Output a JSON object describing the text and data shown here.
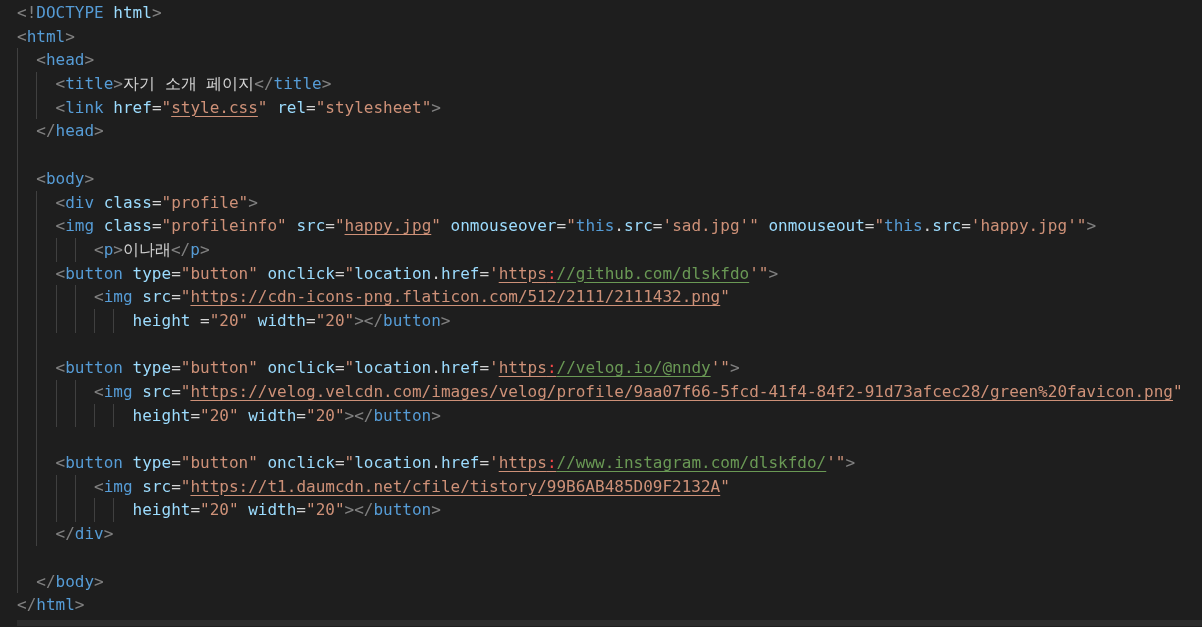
{
  "editor": {
    "lines": [
      {
        "kind": "code",
        "tokens": [
          {
            "kind": "punct",
            "text": "<!"
          },
          {
            "kind": "tag",
            "text": "DOCTYPE"
          },
          {
            "kind": "attr",
            "text": " html"
          },
          {
            "kind": "punct",
            "text": ">"
          }
        ]
      },
      {
        "kind": "code",
        "tokens": [
          {
            "kind": "punct",
            "text": "<"
          },
          {
            "kind": "tag",
            "text": "html"
          },
          {
            "kind": "punct",
            "text": ">"
          }
        ]
      },
      {
        "kind": "code",
        "tokens": [
          {
            "kind": "punct",
            "text": "  <"
          },
          {
            "kind": "tag",
            "text": "head"
          },
          {
            "kind": "punct",
            "text": ">"
          }
        ]
      },
      {
        "kind": "code",
        "tokens": [
          {
            "kind": "punct",
            "text": "    <"
          },
          {
            "kind": "tag",
            "text": "title"
          },
          {
            "kind": "punct",
            "text": ">"
          },
          {
            "kind": "text",
            "text": "자기 소개 페이지"
          },
          {
            "kind": "punct",
            "text": "</"
          },
          {
            "kind": "tag",
            "text": "title"
          },
          {
            "kind": "punct",
            "text": ">"
          }
        ]
      },
      {
        "kind": "code",
        "tokens": [
          {
            "kind": "punct",
            "text": "    <"
          },
          {
            "kind": "tag",
            "text": "link"
          },
          {
            "kind": "attr",
            "text": " href"
          },
          {
            "kind": "text",
            "text": "="
          },
          {
            "kind": "string",
            "text": "\""
          },
          {
            "kind": "link",
            "text": "style.css"
          },
          {
            "kind": "string",
            "text": "\""
          },
          {
            "kind": "attr",
            "text": " rel"
          },
          {
            "kind": "text",
            "text": "="
          },
          {
            "kind": "string",
            "text": "\"stylesheet\""
          },
          {
            "kind": "punct",
            "text": ">"
          }
        ]
      },
      {
        "kind": "code",
        "tokens": [
          {
            "kind": "punct",
            "text": "  </"
          },
          {
            "kind": "tag",
            "text": "head"
          },
          {
            "kind": "punct",
            "text": ">"
          }
        ]
      },
      {
        "kind": "blank"
      },
      {
        "kind": "code",
        "tokens": [
          {
            "kind": "punct",
            "text": "  <"
          },
          {
            "kind": "tag",
            "text": "body"
          },
          {
            "kind": "punct",
            "text": ">"
          }
        ]
      },
      {
        "kind": "code",
        "tokens": [
          {
            "kind": "punct",
            "text": "    <"
          },
          {
            "kind": "tag",
            "text": "div"
          },
          {
            "kind": "attr",
            "text": " class"
          },
          {
            "kind": "text",
            "text": "="
          },
          {
            "kind": "string",
            "text": "\"profile\""
          },
          {
            "kind": "punct",
            "text": ">"
          }
        ]
      },
      {
        "kind": "code",
        "tokens": [
          {
            "kind": "punct",
            "text": "    <"
          },
          {
            "kind": "tag",
            "text": "img"
          },
          {
            "kind": "attr",
            "text": " class"
          },
          {
            "kind": "text",
            "text": "="
          },
          {
            "kind": "string",
            "text": "\"profileinfo\""
          },
          {
            "kind": "attr",
            "text": " src"
          },
          {
            "kind": "text",
            "text": "="
          },
          {
            "kind": "string",
            "text": "\""
          },
          {
            "kind": "link",
            "text": "happy.jpg"
          },
          {
            "kind": "string",
            "text": "\""
          },
          {
            "kind": "attr",
            "text": " onmouseover"
          },
          {
            "kind": "text",
            "text": "="
          },
          {
            "kind": "string",
            "text": "\""
          },
          {
            "kind": "keyword",
            "text": "this"
          },
          {
            "kind": "text",
            "text": "."
          },
          {
            "kind": "prop",
            "text": "src"
          },
          {
            "kind": "text",
            "text": "="
          },
          {
            "kind": "string",
            "text": "'sad.jpg'\""
          },
          {
            "kind": "attr",
            "text": " onmouseout"
          },
          {
            "kind": "text",
            "text": "="
          },
          {
            "kind": "string",
            "text": "\""
          },
          {
            "kind": "keyword",
            "text": "this"
          },
          {
            "kind": "text",
            "text": "."
          },
          {
            "kind": "prop",
            "text": "src"
          },
          {
            "kind": "text",
            "text": "="
          },
          {
            "kind": "string",
            "text": "'happy.jpg'\""
          },
          {
            "kind": "punct",
            "text": ">"
          }
        ]
      },
      {
        "kind": "code",
        "tokens": [
          {
            "kind": "punct",
            "text": "        <"
          },
          {
            "kind": "tag",
            "text": "p"
          },
          {
            "kind": "punct",
            "text": ">"
          },
          {
            "kind": "text",
            "text": "이나래"
          },
          {
            "kind": "punct",
            "text": "</"
          },
          {
            "kind": "tag",
            "text": "p"
          },
          {
            "kind": "punct",
            "text": ">"
          }
        ]
      },
      {
        "kind": "code",
        "tokens": [
          {
            "kind": "punct",
            "text": "    <"
          },
          {
            "kind": "tag",
            "text": "button"
          },
          {
            "kind": "attr",
            "text": " type"
          },
          {
            "kind": "text",
            "text": "="
          },
          {
            "kind": "string",
            "text": "\"button\""
          },
          {
            "kind": "attr",
            "text": " onclick"
          },
          {
            "kind": "text",
            "text": "="
          },
          {
            "kind": "string",
            "text": "\""
          },
          {
            "kind": "prop",
            "text": "location"
          },
          {
            "kind": "text",
            "text": "."
          },
          {
            "kind": "prop",
            "text": "href"
          },
          {
            "kind": "text",
            "text": "="
          },
          {
            "kind": "string",
            "text": "'"
          },
          {
            "kind": "link",
            "text": "https"
          },
          {
            "kind": "error-link",
            "text": ":"
          },
          {
            "kind": "comment-link",
            "text": "//github.com/dlskfdo"
          },
          {
            "kind": "string",
            "text": "'\""
          },
          {
            "kind": "punct",
            "text": ">"
          }
        ]
      },
      {
        "kind": "code",
        "tokens": [
          {
            "kind": "punct",
            "text": "        <"
          },
          {
            "kind": "tag",
            "text": "img"
          },
          {
            "kind": "attr",
            "text": " src"
          },
          {
            "kind": "text",
            "text": "="
          },
          {
            "kind": "string",
            "text": "\""
          },
          {
            "kind": "link",
            "text": "https://cdn-icons-png.flaticon.com/512/2111/2111432.png"
          },
          {
            "kind": "string",
            "text": "\""
          }
        ]
      },
      {
        "kind": "code",
        "tokens": [
          {
            "kind": "attr",
            "text": "            height"
          },
          {
            "kind": "text",
            "text": " ="
          },
          {
            "kind": "string",
            "text": "\"20\""
          },
          {
            "kind": "attr",
            "text": " width"
          },
          {
            "kind": "text",
            "text": "="
          },
          {
            "kind": "string",
            "text": "\"20\""
          },
          {
            "kind": "punct",
            "text": "></"
          },
          {
            "kind": "tag",
            "text": "button"
          },
          {
            "kind": "punct",
            "text": ">"
          }
        ]
      },
      {
        "kind": "blank"
      },
      {
        "kind": "code",
        "tokens": [
          {
            "kind": "punct",
            "text": "    <"
          },
          {
            "kind": "tag",
            "text": "button"
          },
          {
            "kind": "attr",
            "text": " type"
          },
          {
            "kind": "text",
            "text": "="
          },
          {
            "kind": "string",
            "text": "\"button\""
          },
          {
            "kind": "attr",
            "text": " onclick"
          },
          {
            "kind": "text",
            "text": "="
          },
          {
            "kind": "string",
            "text": "\""
          },
          {
            "kind": "prop",
            "text": "location"
          },
          {
            "kind": "text",
            "text": "."
          },
          {
            "kind": "prop",
            "text": "href"
          },
          {
            "kind": "text",
            "text": "="
          },
          {
            "kind": "string",
            "text": "'"
          },
          {
            "kind": "link",
            "text": "https"
          },
          {
            "kind": "error-link",
            "text": ":"
          },
          {
            "kind": "comment-link",
            "text": "//velog.io/@nndy"
          },
          {
            "kind": "string",
            "text": "'\""
          },
          {
            "kind": "punct",
            "text": ">"
          }
        ]
      },
      {
        "kind": "code",
        "tokens": [
          {
            "kind": "punct",
            "text": "        <"
          },
          {
            "kind": "tag",
            "text": "img"
          },
          {
            "kind": "attr",
            "text": " src"
          },
          {
            "kind": "text",
            "text": "="
          },
          {
            "kind": "string",
            "text": "\""
          },
          {
            "kind": "link",
            "text": "https://velog.velcdn.com/images/velog/profile/9aa07f66-5fcd-41f4-84f2-91d73afcec28/green%20favicon.png"
          },
          {
            "kind": "string",
            "text": "\""
          }
        ]
      },
      {
        "kind": "code",
        "tokens": [
          {
            "kind": "attr",
            "text": "            height"
          },
          {
            "kind": "text",
            "text": "="
          },
          {
            "kind": "string",
            "text": "\"20\""
          },
          {
            "kind": "attr",
            "text": " width"
          },
          {
            "kind": "text",
            "text": "="
          },
          {
            "kind": "string",
            "text": "\"20\""
          },
          {
            "kind": "punct",
            "text": "></"
          },
          {
            "kind": "tag",
            "text": "button"
          },
          {
            "kind": "punct",
            "text": ">"
          }
        ]
      },
      {
        "kind": "blank"
      },
      {
        "kind": "code",
        "tokens": [
          {
            "kind": "punct",
            "text": "    <"
          },
          {
            "kind": "tag",
            "text": "button"
          },
          {
            "kind": "attr",
            "text": " type"
          },
          {
            "kind": "text",
            "text": "="
          },
          {
            "kind": "string",
            "text": "\"button\""
          },
          {
            "kind": "attr",
            "text": " onclick"
          },
          {
            "kind": "text",
            "text": "="
          },
          {
            "kind": "string",
            "text": "\""
          },
          {
            "kind": "prop",
            "text": "location"
          },
          {
            "kind": "text",
            "text": "."
          },
          {
            "kind": "prop",
            "text": "href"
          },
          {
            "kind": "text",
            "text": "="
          },
          {
            "kind": "string",
            "text": "'"
          },
          {
            "kind": "link",
            "text": "https"
          },
          {
            "kind": "error-link",
            "text": ":"
          },
          {
            "kind": "comment-link",
            "text": "//www.instagram.com/dlskfdo/"
          },
          {
            "kind": "string",
            "text": "'\""
          },
          {
            "kind": "punct",
            "text": ">"
          }
        ]
      },
      {
        "kind": "code",
        "tokens": [
          {
            "kind": "punct",
            "text": "        <"
          },
          {
            "kind": "tag",
            "text": "img"
          },
          {
            "kind": "attr",
            "text": " src"
          },
          {
            "kind": "text",
            "text": "="
          },
          {
            "kind": "string",
            "text": "\""
          },
          {
            "kind": "link",
            "text": "https://t1.daumcdn.net/cfile/tistory/99B6AB485D09F2132A"
          },
          {
            "kind": "string",
            "text": "\""
          }
        ]
      },
      {
        "kind": "code",
        "tokens": [
          {
            "kind": "attr",
            "text": "            height"
          },
          {
            "kind": "text",
            "text": "="
          },
          {
            "kind": "string",
            "text": "\"20\""
          },
          {
            "kind": "attr",
            "text": " width"
          },
          {
            "kind": "text",
            "text": "="
          },
          {
            "kind": "string",
            "text": "\"20\""
          },
          {
            "kind": "punct",
            "text": "></"
          },
          {
            "kind": "tag",
            "text": "button"
          },
          {
            "kind": "punct",
            "text": ">"
          }
        ]
      },
      {
        "kind": "code",
        "tokens": [
          {
            "kind": "punct",
            "text": "    </"
          },
          {
            "kind": "tag",
            "text": "div"
          },
          {
            "kind": "punct",
            "text": ">"
          }
        ]
      },
      {
        "kind": "blank"
      },
      {
        "kind": "code",
        "tokens": [
          {
            "kind": "punct",
            "text": "  </"
          },
          {
            "kind": "tag",
            "text": "body"
          },
          {
            "kind": "punct",
            "text": ">"
          }
        ]
      },
      {
        "kind": "code",
        "tokens": [
          {
            "kind": "punct",
            "text": "</"
          },
          {
            "kind": "tag",
            "text": "html"
          },
          {
            "kind": "punct",
            "text": ">"
          }
        ]
      }
    ]
  }
}
